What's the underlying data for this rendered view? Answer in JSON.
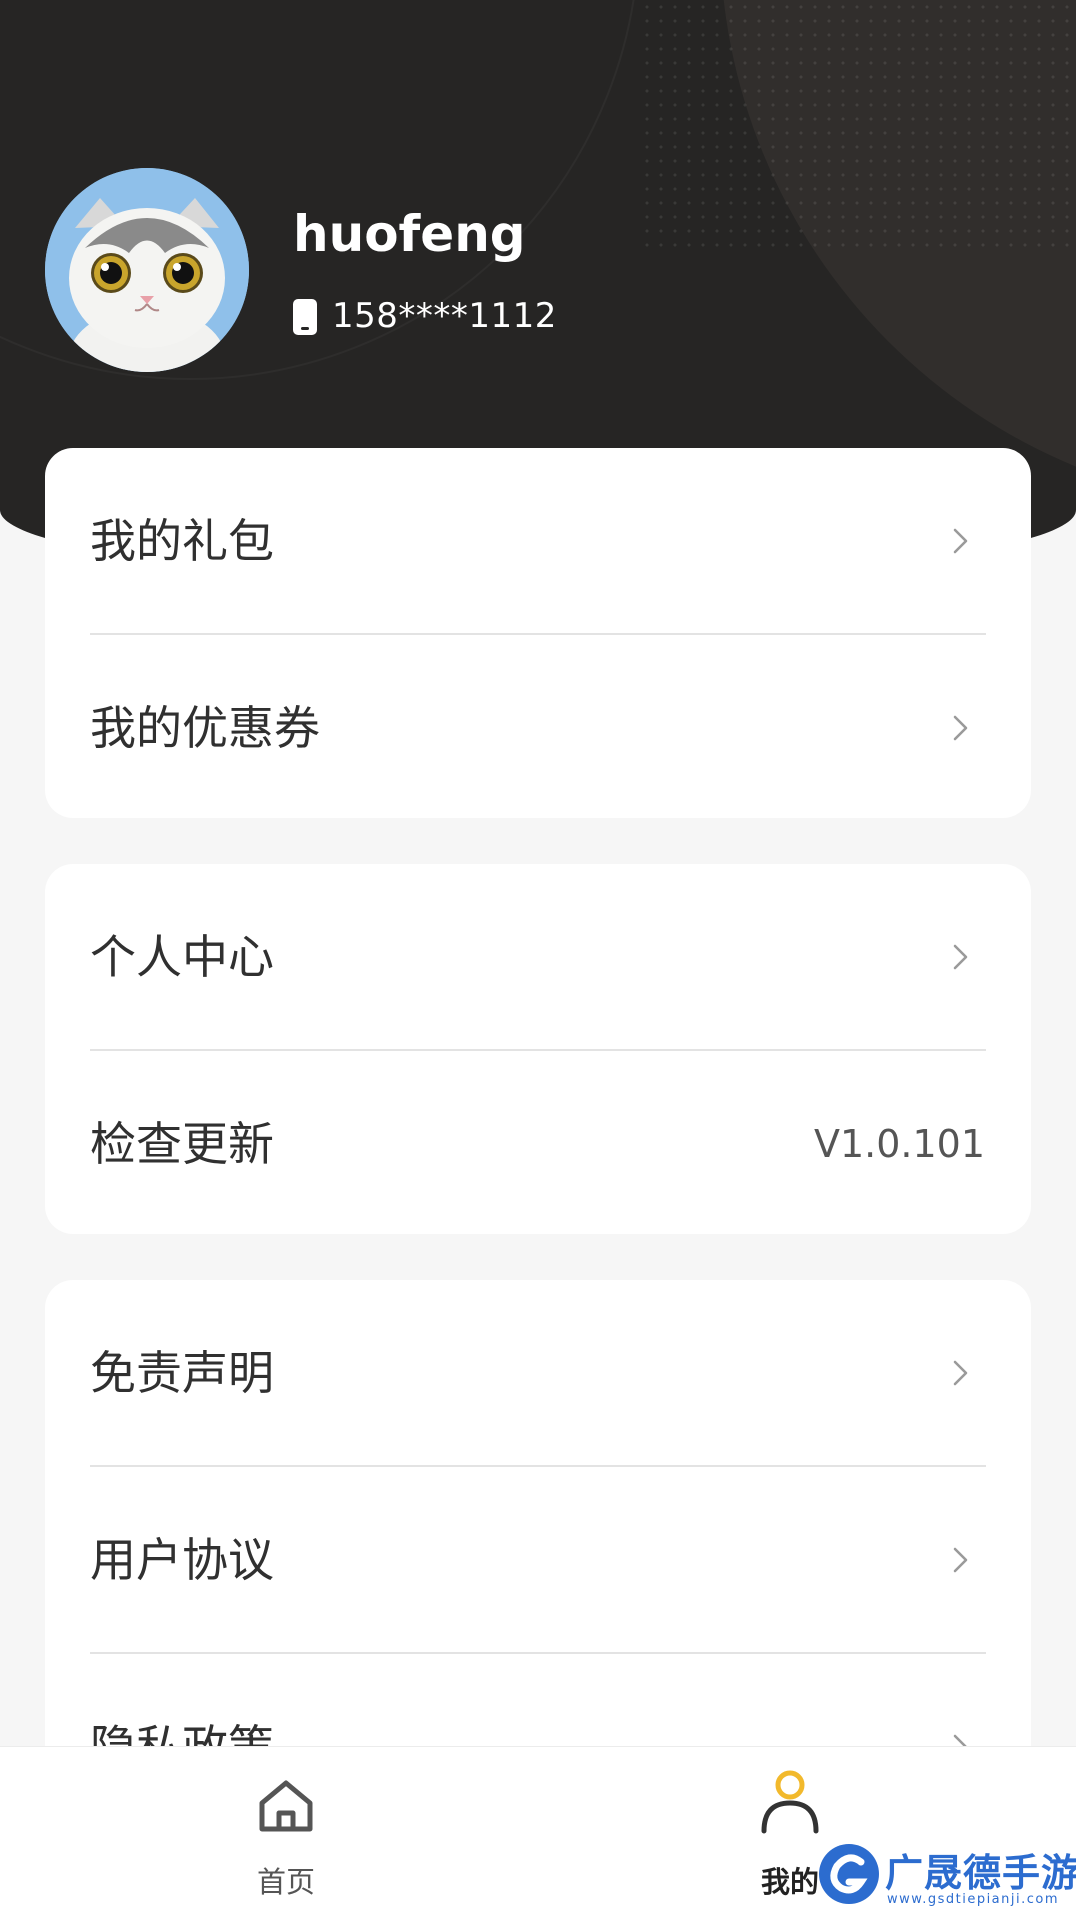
{
  "profile": {
    "username": "huofeng",
    "phone": "158****1112"
  },
  "menu": {
    "group1": [
      {
        "label": "我的礼包"
      },
      {
        "label": "我的优惠券"
      }
    ],
    "group2": [
      {
        "label": "个人中心"
      },
      {
        "label": "检查更新",
        "value": "V1.0.101"
      }
    ],
    "group3": [
      {
        "label": "免责声明"
      },
      {
        "label": "用户协议"
      },
      {
        "label": "隐私政策"
      }
    ]
  },
  "bottom_nav": {
    "items": [
      {
        "label": "首页",
        "icon": "home-icon",
        "active": false
      },
      {
        "label": "我的",
        "icon": "user-icon",
        "active": true
      }
    ]
  },
  "watermark": {
    "text": "广晟德手游",
    "sub": "www.gsdtiepianji.com"
  },
  "colors": {
    "header_bg": "#262524",
    "accent": "#f2b92c",
    "page_bg": "#f6f6f6"
  }
}
